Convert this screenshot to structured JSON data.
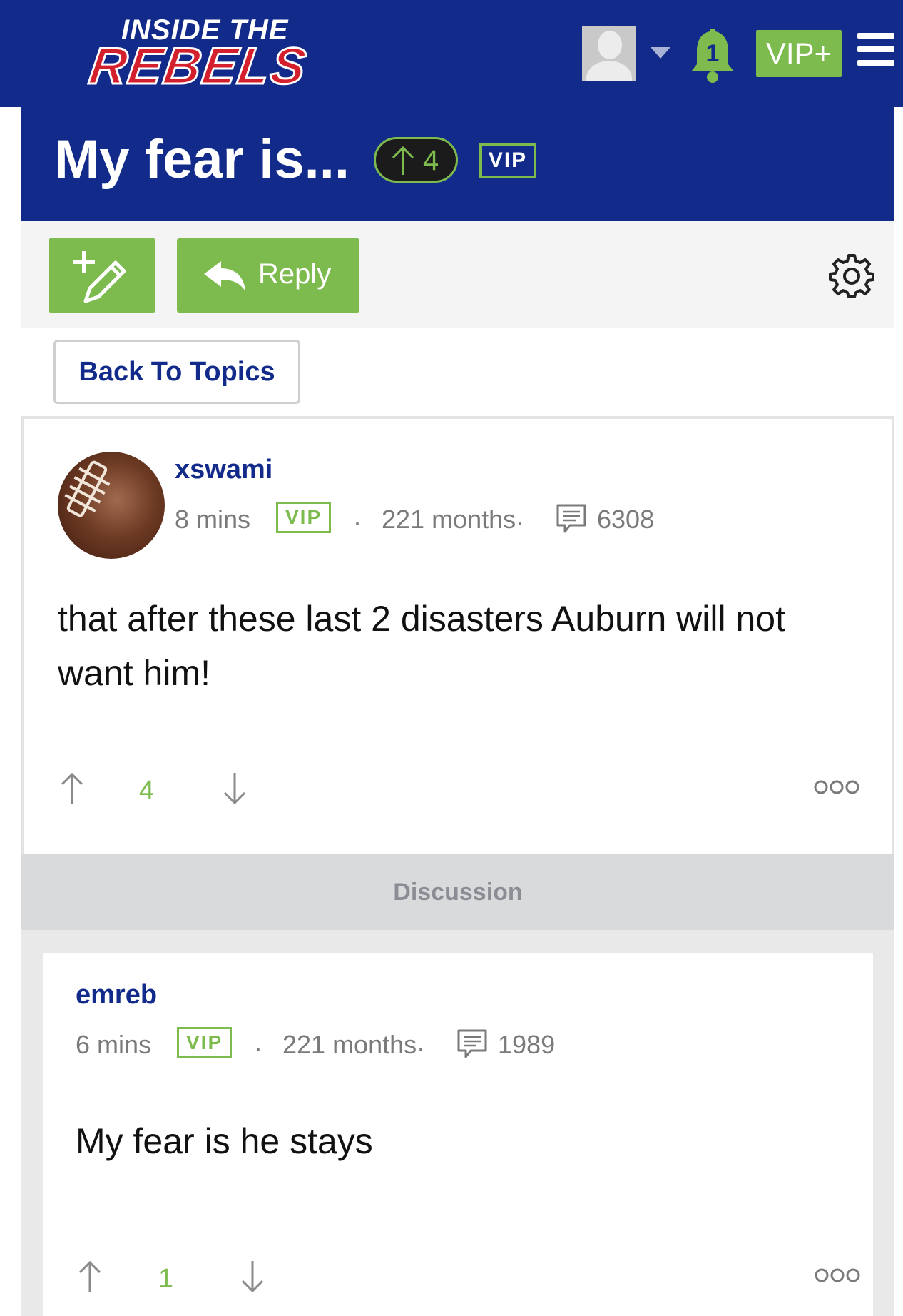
{
  "header": {
    "logo_top": "INSIDE THE",
    "logo_main": "REBELS",
    "notification_count": "1",
    "vip_plus_label": "VIP+",
    "colors": {
      "navy": "#122a8a",
      "green": "#7dbb4f",
      "red": "#d4202c"
    }
  },
  "topic": {
    "title": "My fear is...",
    "votes": "4",
    "vip_badge": "VIP"
  },
  "toolbar": {
    "new_topic_icon": "pencil-plus-icon",
    "reply_label": "Reply",
    "settings_icon": "gear-icon"
  },
  "back_label": "Back To Topics",
  "main_post": {
    "username": "xswami",
    "time": "8 mins",
    "vip_badge": "VIP",
    "tenure": "221 months",
    "post_count": "6308",
    "body": "that after these last 2 disasters Auburn will not want him!",
    "votes": "4",
    "more_label": "ooo"
  },
  "discussion_label": "Discussion",
  "replies": [
    {
      "username": "emreb",
      "time": "6 mins",
      "vip_badge": "VIP",
      "tenure": "221 months",
      "post_count": "1989",
      "body": "My fear is he stays",
      "votes": "1",
      "more_label": "ooo"
    }
  ]
}
